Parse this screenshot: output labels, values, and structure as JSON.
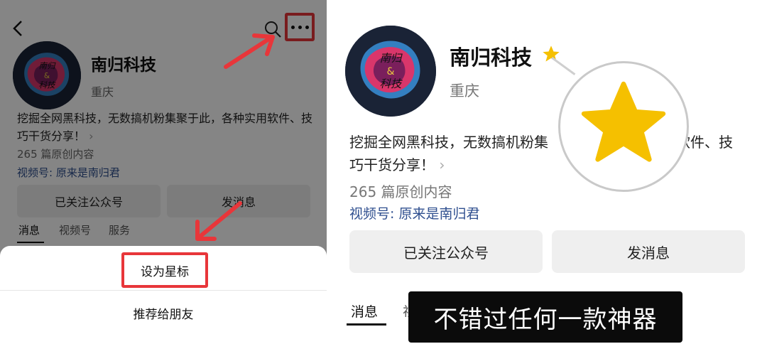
{
  "left": {
    "account": {
      "name": "南归科技",
      "location": "重庆",
      "avatar_text": [
        "南归",
        "&",
        "科技"
      ],
      "description": "挖掘全网黑科技，无数搞机粉集聚于此，各种实用软件、技巧干货分享！",
      "article_count": "265 篇原创内容",
      "video_channel": "视频号: 原来是南归君"
    },
    "buttons": {
      "followed": "已关注公众号",
      "message": "发消息"
    },
    "tabs": [
      "消息",
      "视频号",
      "服务"
    ],
    "sheet": {
      "option_star": "设为星标",
      "option_recommend": "推荐给朋友"
    },
    "icons": [
      "back-icon",
      "search-icon",
      "more-icon",
      "arrow-icon"
    ],
    "highlight_color": "#e8363a"
  },
  "right": {
    "account": {
      "name": "南归科技",
      "location": "重庆",
      "avatar_text": [
        "南归",
        "&",
        "科技"
      ],
      "description_line1": "挖掘全网黑科技，无数搞机粉集",
      "description_line1_end": "软件、技",
      "description_line2": "巧干货分享！",
      "article_count": "265 篇原创内容",
      "video_channel": "视频号: 原来是南归君"
    },
    "buttons": {
      "followed": "已关注公众号",
      "message": "发消息"
    },
    "tabs": [
      "消息"
    ],
    "subtitle": "不错过任何一款神器",
    "star_color": "#f5c000",
    "icons": [
      "star-icon"
    ]
  }
}
